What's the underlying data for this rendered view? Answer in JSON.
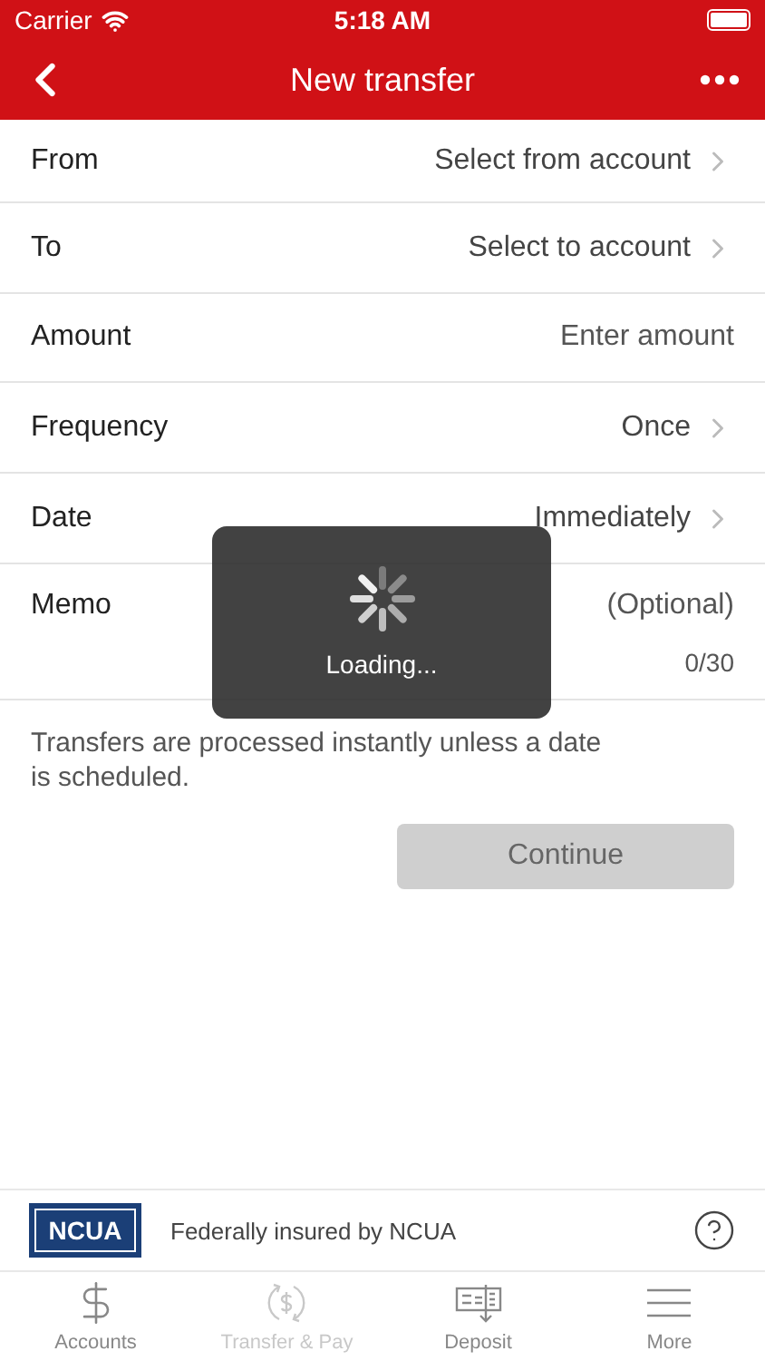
{
  "status_bar": {
    "carrier": "Carrier",
    "time": "5:18 AM"
  },
  "nav": {
    "title": "New transfer"
  },
  "rows": [
    {
      "kind": "picker",
      "label": "From",
      "value": "Select from account"
    },
    {
      "kind": "picker",
      "label": "To",
      "value": "Select to account"
    },
    {
      "kind": "input",
      "label": "Amount",
      "placeholder": "Enter amount"
    },
    {
      "kind": "picker",
      "label": "Frequency",
      "value": "Once"
    },
    {
      "kind": "picker",
      "label": "Date",
      "value": "Immediately"
    },
    {
      "kind": "memo",
      "label": "Memo",
      "placeholder": "(Optional)",
      "counter": "0/30"
    }
  ],
  "note": "Transfers are processed instantly unless a date is scheduled.",
  "continue_button": {
    "label": "Continue",
    "disabled": true
  },
  "loading": {
    "text": "Loading..."
  },
  "footer": {
    "logo": "NCUA",
    "text": "Federally insured by NCUA"
  },
  "tabs": [
    {
      "label": "Accounts",
      "kind": "dollar",
      "selected": false,
      "disabled": false
    },
    {
      "label": "Transfer & Pay",
      "kind": "transfer",
      "selected": false,
      "disabled": true
    },
    {
      "label": "Deposit",
      "kind": "deposit",
      "selected": false,
      "disabled": false
    },
    {
      "label": "More",
      "kind": "more",
      "selected": false,
      "disabled": false
    }
  ]
}
